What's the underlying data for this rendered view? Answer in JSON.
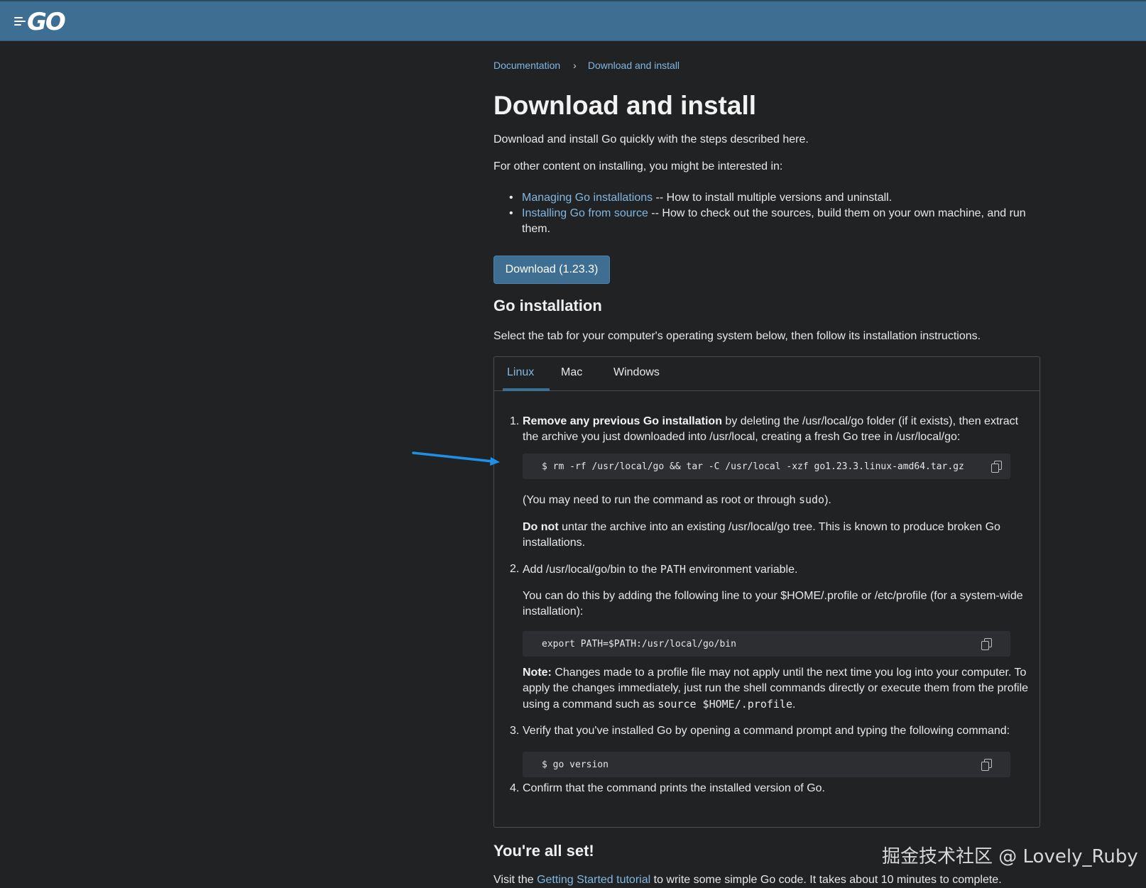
{
  "header": {
    "logo_text": "GO"
  },
  "breadcrumb": {
    "items": [
      "Documentation",
      "Download and install"
    ],
    "separator": "›"
  },
  "page": {
    "title": "Download and install",
    "intro": "Download and install Go quickly with the steps described here.",
    "other_content": "For other content on installing, you might be interested in:",
    "links": [
      {
        "link": "Managing Go installations",
        "text": " -- How to install multiple versions and uninstall."
      },
      {
        "link": "Installing Go from source",
        "text": " -- How to check out the sources, build them on your own machine, and run them."
      }
    ],
    "download_button": "Download (1.23.3)",
    "section_title": "Go installation",
    "section_intro": "Select the tab for your computer's operating system below, then follow its installation instructions."
  },
  "tabs": {
    "items": [
      "Linux",
      "Mac",
      "Windows"
    ],
    "active": "Linux"
  },
  "steps": {
    "s1": {
      "num": "1.",
      "bold": "Remove any previous Go installation",
      "text": " by deleting the /usr/local/go folder (if it exists), then extract the archive you just downloaded into /usr/local, creating a fresh Go tree in /usr/local/go:",
      "code": "$ rm -rf /usr/local/go && tar -C /usr/local -xzf go1.23.3.linux-amd64.tar.gz",
      "note1_pre": "(You may need to run the command as root or through ",
      "note1_code": "sudo",
      "note1_post": ").",
      "note2_bold": "Do not",
      "note2_text": " untar the archive into an existing /usr/local/go tree. This is known to produce broken Go installations."
    },
    "s2": {
      "num": "2.",
      "pre": "Add /usr/local/go/bin to the ",
      "code_inline": "PATH",
      "post": " environment variable.",
      "desc": "You can do this by adding the following line to your $HOME/.profile or /etc/profile (for a system-wide installation):",
      "code": "export PATH=$PATH:/usr/local/go/bin",
      "note_bold": "Note:",
      "note_text": " Changes made to a profile file may not apply until the next time you log into your computer. To apply the changes immediately, just run the shell commands directly or execute them from the profile using a command such as ",
      "note_code": "source $HOME/.profile",
      "note_end": "."
    },
    "s3": {
      "num": "3.",
      "text": "Verify that you've installed Go by opening a command prompt and typing the following command:",
      "code": "$ go version"
    },
    "s4": {
      "num": "4.",
      "text": "Confirm that the command prints the installed version of Go."
    }
  },
  "footer_section": {
    "title": "You're all set!",
    "pre": "Visit the ",
    "link": "Getting Started tutorial",
    "post": " to write some simple Go code. It takes about 10 minutes to complete."
  },
  "watermark": "掘金技术社区 @ Lovely_Ruby",
  "colors": {
    "header": "#3e6f93",
    "link": "#82b7e2",
    "background": "#202224",
    "annotation_arrow": "#1e90e8"
  }
}
